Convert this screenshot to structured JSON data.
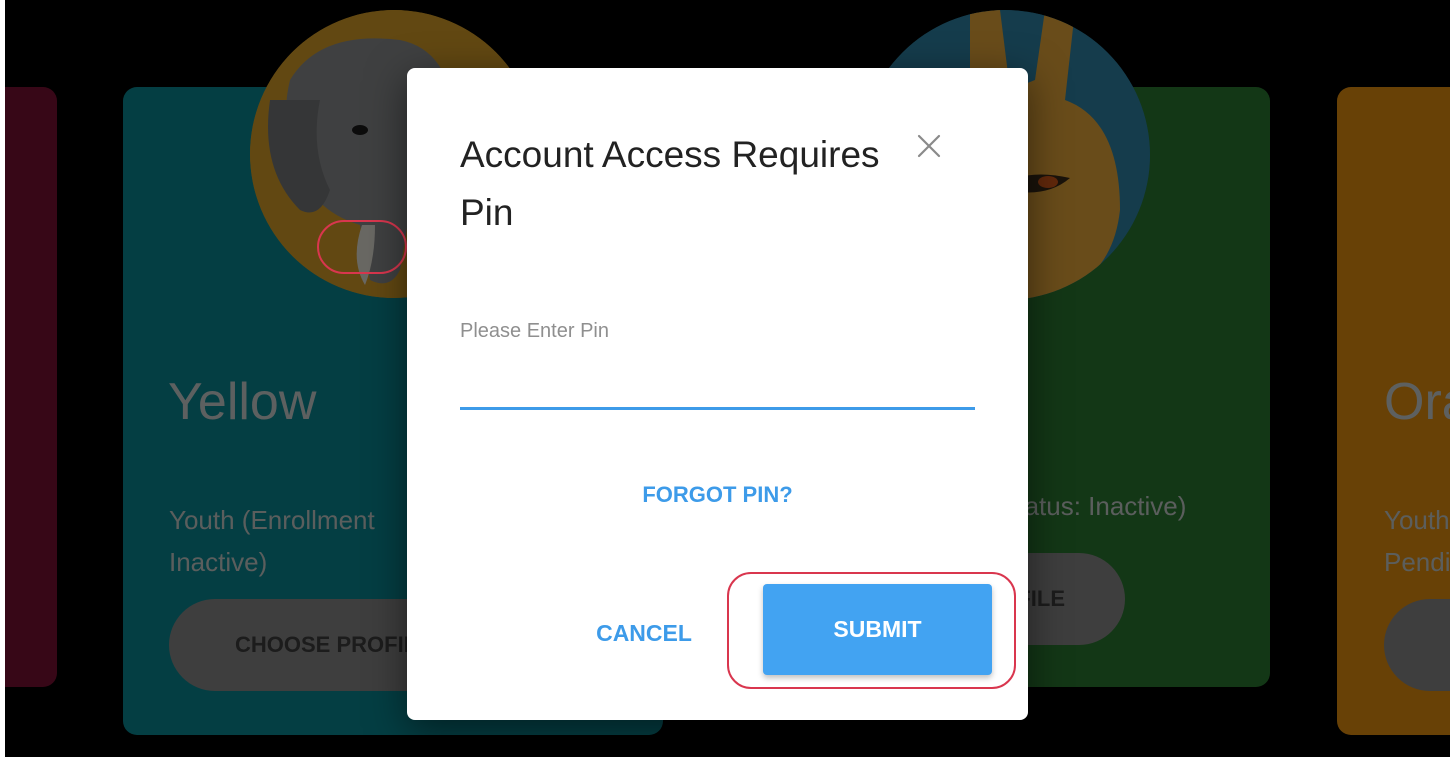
{
  "cards": [
    {
      "id": "pink",
      "color": "#7b1133"
    },
    {
      "id": "yellow",
      "color": "#0b8b96",
      "title": "Yellow",
      "subtitle_line1": "Youth (Enrollment",
      "subtitle_line2": "Inactive)",
      "button": "CHOOSE PROFILE",
      "avatar_icon": "elephant-icon"
    },
    {
      "id": "green",
      "color": "#2a7a32",
      "subtitle_line1": "Status: Inactive)",
      "button": "CHOOSE PROFILE",
      "avatar_icon": "giraffe-icon"
    },
    {
      "id": "orange",
      "color": "#e7900f",
      "title": "Orange",
      "subtitle_line1": "Youth",
      "subtitle_line2": "Pending"
    }
  ],
  "modal": {
    "title": "Account Access Requires Pin",
    "close_icon": "close-icon",
    "pin_label": "Please Enter Pin",
    "pin_value": "",
    "forgot_link": "FORGOT PIN?",
    "cancel_label": "CANCEL",
    "submit_label": "SUBMIT",
    "accent_color": "#42a3f2"
  }
}
